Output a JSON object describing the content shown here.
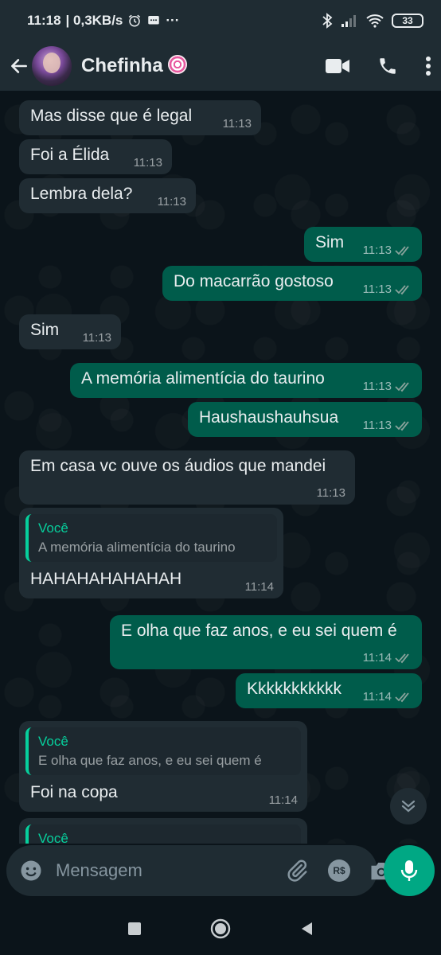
{
  "status_bar": {
    "time": "11:18",
    "network_speed": "| 0,3KB/s",
    "more_indicator": "···",
    "battery": "33"
  },
  "header": {
    "contact_name": "Chefinha"
  },
  "messages": [
    {
      "dir": "in",
      "text": "Mas disse que é legal",
      "time": "11:13"
    },
    {
      "dir": "in",
      "text": "Foi a Élida",
      "time": "11:13"
    },
    {
      "dir": "in",
      "text": "Lembra dela?",
      "time": "11:13"
    },
    {
      "dir": "out",
      "text": "Sim",
      "time": "11:13"
    },
    {
      "dir": "out",
      "text": "Do macarrão gostoso",
      "time": "11:13"
    },
    {
      "dir": "in",
      "text": "Sim",
      "time": "11:13"
    },
    {
      "dir": "out",
      "text": "A memória alimentícia do taurino",
      "time": "11:13"
    },
    {
      "dir": "out",
      "text": "Haushaushauhsua",
      "time": "11:13"
    },
    {
      "dir": "in",
      "text": "Em casa vc ouve os áudios que mandei",
      "time": "11:13"
    },
    {
      "dir": "in",
      "quote_author": "Você",
      "quote_text": "A memória alimentícia do taurino",
      "text": "HAHAHAHAHAHAH",
      "time": "11:14"
    },
    {
      "dir": "out",
      "text": "E olha que faz anos, e eu sei quem é",
      "time": "11:14"
    },
    {
      "dir": "out",
      "text": "Kkkkkkkkkkk",
      "time": "11:14"
    },
    {
      "dir": "in",
      "quote_author": "Você",
      "quote_text": "E olha que faz anos, e eu sei quem é",
      "text": "Foi na copa",
      "time": "11:14"
    },
    {
      "dir": "in",
      "quote_author": "Você"
    }
  ],
  "composer": {
    "placeholder": "Mensagem",
    "currency_label": "R$"
  },
  "colors": {
    "background": "#0b141a",
    "bar": "#1f2c33",
    "incoming_bubble": "#202c33",
    "outgoing_bubble": "#005c4b",
    "accent": "#00a884",
    "quote_accent": "#06cf9c"
  },
  "icons": [
    "back-arrow-icon",
    "video-call-icon",
    "phone-icon",
    "more-vertical-icon",
    "emoji-icon",
    "attach-icon",
    "camera-icon",
    "mic-icon",
    "double-check-icon",
    "chevron-double-down-icon"
  ]
}
